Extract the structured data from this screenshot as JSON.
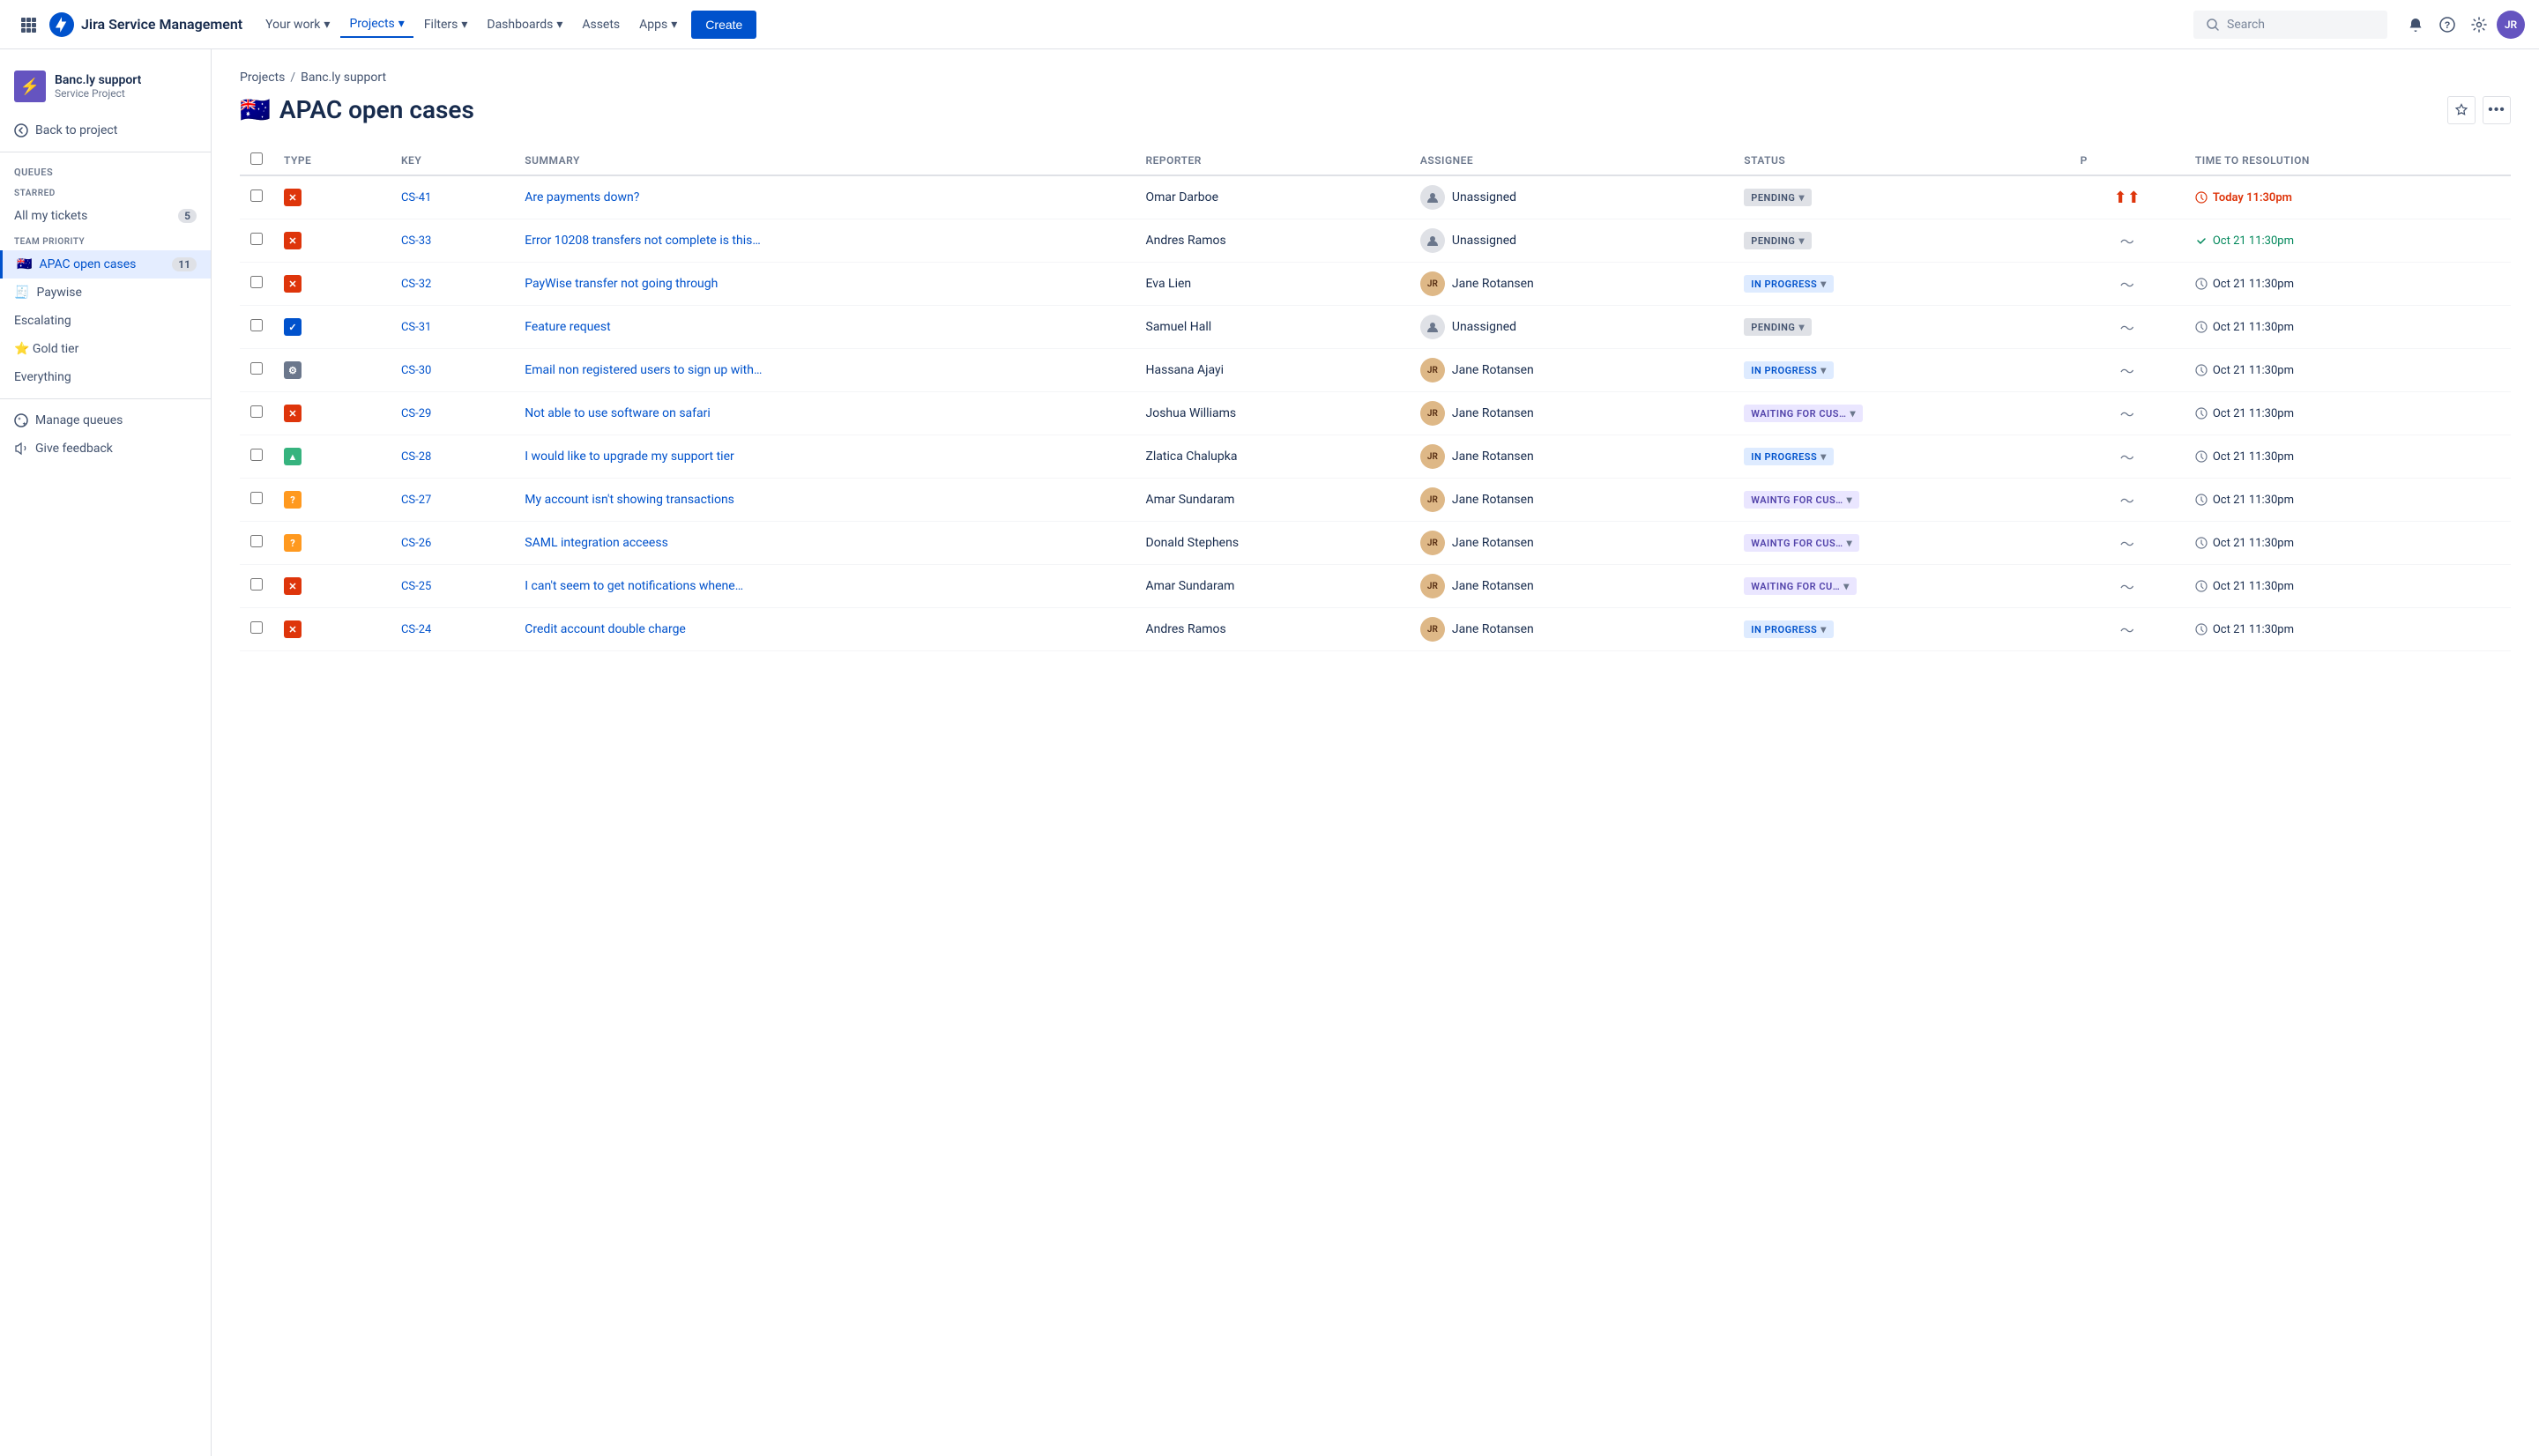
{
  "app": {
    "name": "Jira Service Management",
    "logo_color": "#0052CC"
  },
  "nav": {
    "your_work": "Your work",
    "projects": "Projects",
    "filters": "Filters",
    "dashboards": "Dashboards",
    "assets": "Assets",
    "apps": "Apps",
    "create": "Create",
    "search_placeholder": "Search"
  },
  "sidebar": {
    "project_name": "Banc.ly support",
    "project_type": "Service Project",
    "back_label": "Back to project",
    "queues_label": "Queues",
    "starred_label": "STARRED",
    "team_priority_label": "TEAM PRIORITY",
    "all_tickets_label": "All my tickets",
    "all_tickets_count": "5",
    "apac_label": "APAC open cases",
    "apac_count": "11",
    "paywise_label": "Paywise",
    "escalating_label": "Escalating",
    "gold_tier_label": "⭐ Gold tier",
    "everything_label": "Everything",
    "manage_queues_label": "Manage queues",
    "give_feedback_label": "Give feedback"
  },
  "breadcrumb": {
    "projects": "Projects",
    "project_name": "Banc.ly support"
  },
  "page": {
    "title": "APAC open cases",
    "emoji": "🇦🇺"
  },
  "table": {
    "columns": {
      "type": "Type",
      "key": "Key",
      "summary": "Summary",
      "reporter": "Reporter",
      "assignee": "Assignee",
      "status": "Status",
      "priority": "P",
      "time": "Time to resolution"
    },
    "rows": [
      {
        "type": "bug",
        "key": "CS-41",
        "summary": "Are payments down?",
        "reporter": "Omar Darboe",
        "assignee": "Unassigned",
        "assignee_type": "unassigned",
        "status": "PENDING",
        "status_type": "pending",
        "priority": "highest",
        "time": "Today 11:30pm",
        "time_type": "overdue"
      },
      {
        "type": "bug",
        "key": "CS-33",
        "summary": "Error 10208 transfers not complete is this…",
        "reporter": "Andres Ramos",
        "assignee": "Unassigned",
        "assignee_type": "unassigned",
        "status": "PENDING",
        "status_type": "pending",
        "priority": "medium",
        "time": "Oct 21 11:30pm",
        "time_type": "ok"
      },
      {
        "type": "bug",
        "key": "CS-32",
        "summary": "PayWise transfer not going through",
        "reporter": "Eva Lien",
        "assignee": "Jane Rotansen",
        "assignee_type": "avatar",
        "status": "IN PROGRESS",
        "status_type": "in-progress",
        "priority": "medium",
        "time": "Oct 21 11:30pm",
        "time_type": "normal"
      },
      {
        "type": "task",
        "key": "CS-31",
        "summary": "Feature request",
        "reporter": "Samuel Hall",
        "assignee": "Unassigned",
        "assignee_type": "unassigned",
        "status": "PENDING",
        "status_type": "pending",
        "priority": "medium",
        "time": "Oct 21 11:30pm",
        "time_type": "normal"
      },
      {
        "type": "cog",
        "key": "CS-30",
        "summary": "Email non registered users to sign up with…",
        "reporter": "Hassana Ajayi",
        "assignee": "Jane Rotansen",
        "assignee_type": "avatar",
        "status": "IN PROGRESS",
        "status_type": "in-progress",
        "priority": "medium",
        "time": "Oct 21 11:30pm",
        "time_type": "normal"
      },
      {
        "type": "bug",
        "key": "CS-29",
        "summary": "Not able to use software on safari",
        "reporter": "Joshua Williams",
        "assignee": "Jane Rotansen",
        "assignee_type": "avatar",
        "status": "WAITING FOR CUS…",
        "status_type": "waiting",
        "priority": "medium",
        "time": "Oct 21 11:30pm",
        "time_type": "normal"
      },
      {
        "type": "story",
        "key": "CS-28",
        "summary": "I would like to upgrade my support tier",
        "reporter": "Zlatica Chalupka",
        "assignee": "Jane Rotansen",
        "assignee_type": "avatar",
        "status": "IN PROGRESS",
        "status_type": "in-progress",
        "priority": "medium",
        "time": "Oct 21 11:30pm",
        "time_type": "normal"
      },
      {
        "type": "question",
        "key": "CS-27",
        "summary": "My account isn't showing transactions",
        "reporter": "Amar Sundaram",
        "assignee": "Jane Rotansen",
        "assignee_type": "avatar",
        "status": "WAINTG FOR CUS…",
        "status_type": "waiting",
        "priority": "medium",
        "time": "Oct 21 11:30pm",
        "time_type": "normal"
      },
      {
        "type": "question",
        "key": "CS-26",
        "summary": "SAML integration acceess",
        "reporter": "Donald Stephens",
        "assignee": "Jane Rotansen",
        "assignee_type": "avatar",
        "status": "WAINTG FOR CUS…",
        "status_type": "waiting",
        "priority": "medium",
        "time": "Oct 21 11:30pm",
        "time_type": "normal"
      },
      {
        "type": "bug",
        "key": "CS-25",
        "summary": "I can't seem to get notifications whene…",
        "reporter": "Amar Sundaram",
        "assignee": "Jane Rotansen",
        "assignee_type": "avatar",
        "status": "WAITING FOR CU…",
        "status_type": "waiting",
        "priority": "medium",
        "time": "Oct 21 11:30pm",
        "time_type": "normal"
      },
      {
        "type": "bug",
        "key": "CS-24",
        "summary": "Credit account double charge",
        "reporter": "Andres Ramos",
        "assignee": "Jane Rotansen",
        "assignee_type": "avatar",
        "status": "IN PROGRESS",
        "status_type": "in-progress",
        "priority": "medium",
        "time": "Oct 21 11:30pm",
        "time_type": "normal"
      }
    ]
  }
}
